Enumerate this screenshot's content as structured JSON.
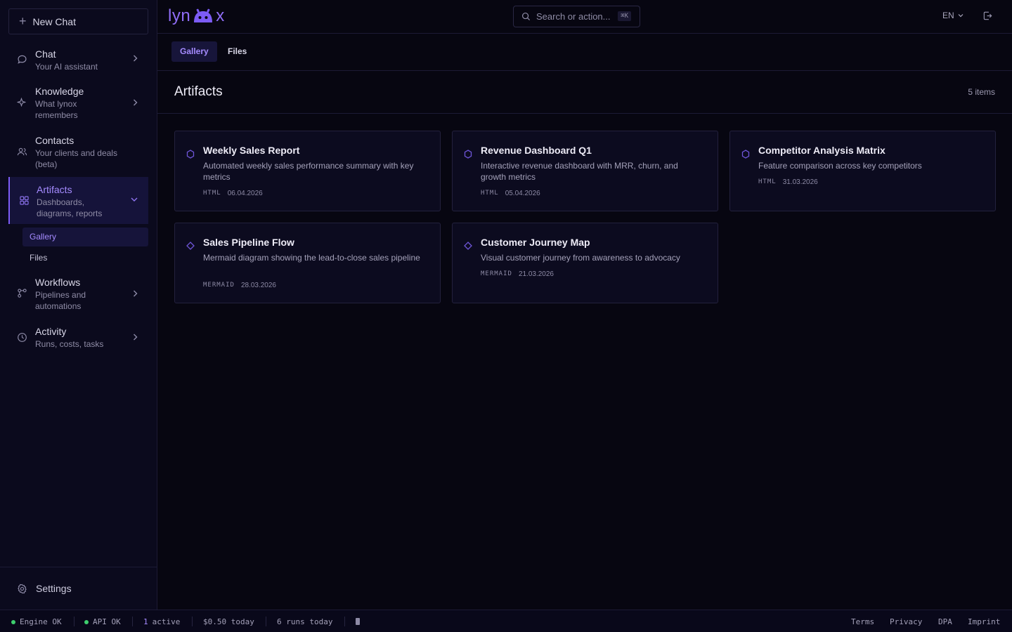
{
  "sidebar": {
    "new_chat": "New Chat",
    "items": [
      {
        "title": "Chat",
        "subtitle": "Your AI assistant",
        "icon": "chat-bubble-icon"
      },
      {
        "title": "Knowledge",
        "subtitle": "What lynox remembers",
        "icon": "sparkle-icon"
      },
      {
        "title": "Contacts",
        "subtitle": "Your clients and deals (beta)",
        "icon": "users-icon"
      },
      {
        "title": "Artifacts",
        "subtitle": "Dashboards, diagrams, reports",
        "icon": "grid-icon"
      },
      {
        "title": "Workflows",
        "subtitle": "Pipelines and automations",
        "icon": "workflow-icon"
      },
      {
        "title": "Activity",
        "subtitle": "Runs, costs, tasks",
        "icon": "clock-icon"
      }
    ],
    "artifacts_sub": [
      {
        "label": "Gallery"
      },
      {
        "label": "Files"
      }
    ],
    "settings": "Settings"
  },
  "topbar": {
    "logo_left": "lyn",
    "logo_right": "x",
    "search_placeholder": "Search or action...",
    "search_shortcut": "⌘K",
    "lang": "EN"
  },
  "tabs": [
    {
      "label": "Gallery"
    },
    {
      "label": "Files"
    }
  ],
  "page": {
    "title": "Artifacts",
    "count": "5 items"
  },
  "cards": [
    {
      "title": "Weekly Sales Report",
      "description": "Automated weekly sales performance summary with key metrics",
      "kind": "HTML",
      "date": "06.04.2026",
      "icon": "hexagon-icon"
    },
    {
      "title": "Revenue Dashboard Q1",
      "description": "Interactive revenue dashboard with MRR, churn, and growth metrics",
      "kind": "HTML",
      "date": "05.04.2026",
      "icon": "hexagon-icon"
    },
    {
      "title": "Competitor Analysis Matrix",
      "description": "Feature comparison across key competitors",
      "kind": "HTML",
      "date": "31.03.2026",
      "icon": "hexagon-icon"
    },
    {
      "title": "Sales Pipeline Flow",
      "description": "Mermaid diagram showing the lead-to-close sales pipeline",
      "kind": "MERMAID",
      "date": "28.03.2026",
      "icon": "diamond-icon"
    },
    {
      "title": "Customer Journey Map",
      "description": "Visual customer journey from awareness to advocacy",
      "kind": "MERMAID",
      "date": "21.03.2026",
      "icon": "diamond-icon"
    }
  ],
  "statusbar": {
    "engine": "Engine OK",
    "api": "API OK",
    "active_count": "1",
    "active_label": "active",
    "cost": "$0.50 today",
    "runs": "6 runs today",
    "links": [
      "Terms",
      "Privacy",
      "DPA",
      "Imprint"
    ]
  },
  "colors": {
    "accent": "#7c5cf5",
    "accent_text": "#a58bff",
    "background": "#070611",
    "sidebar": "#0b0a1d",
    "status_ok": "#3ecf6e"
  }
}
